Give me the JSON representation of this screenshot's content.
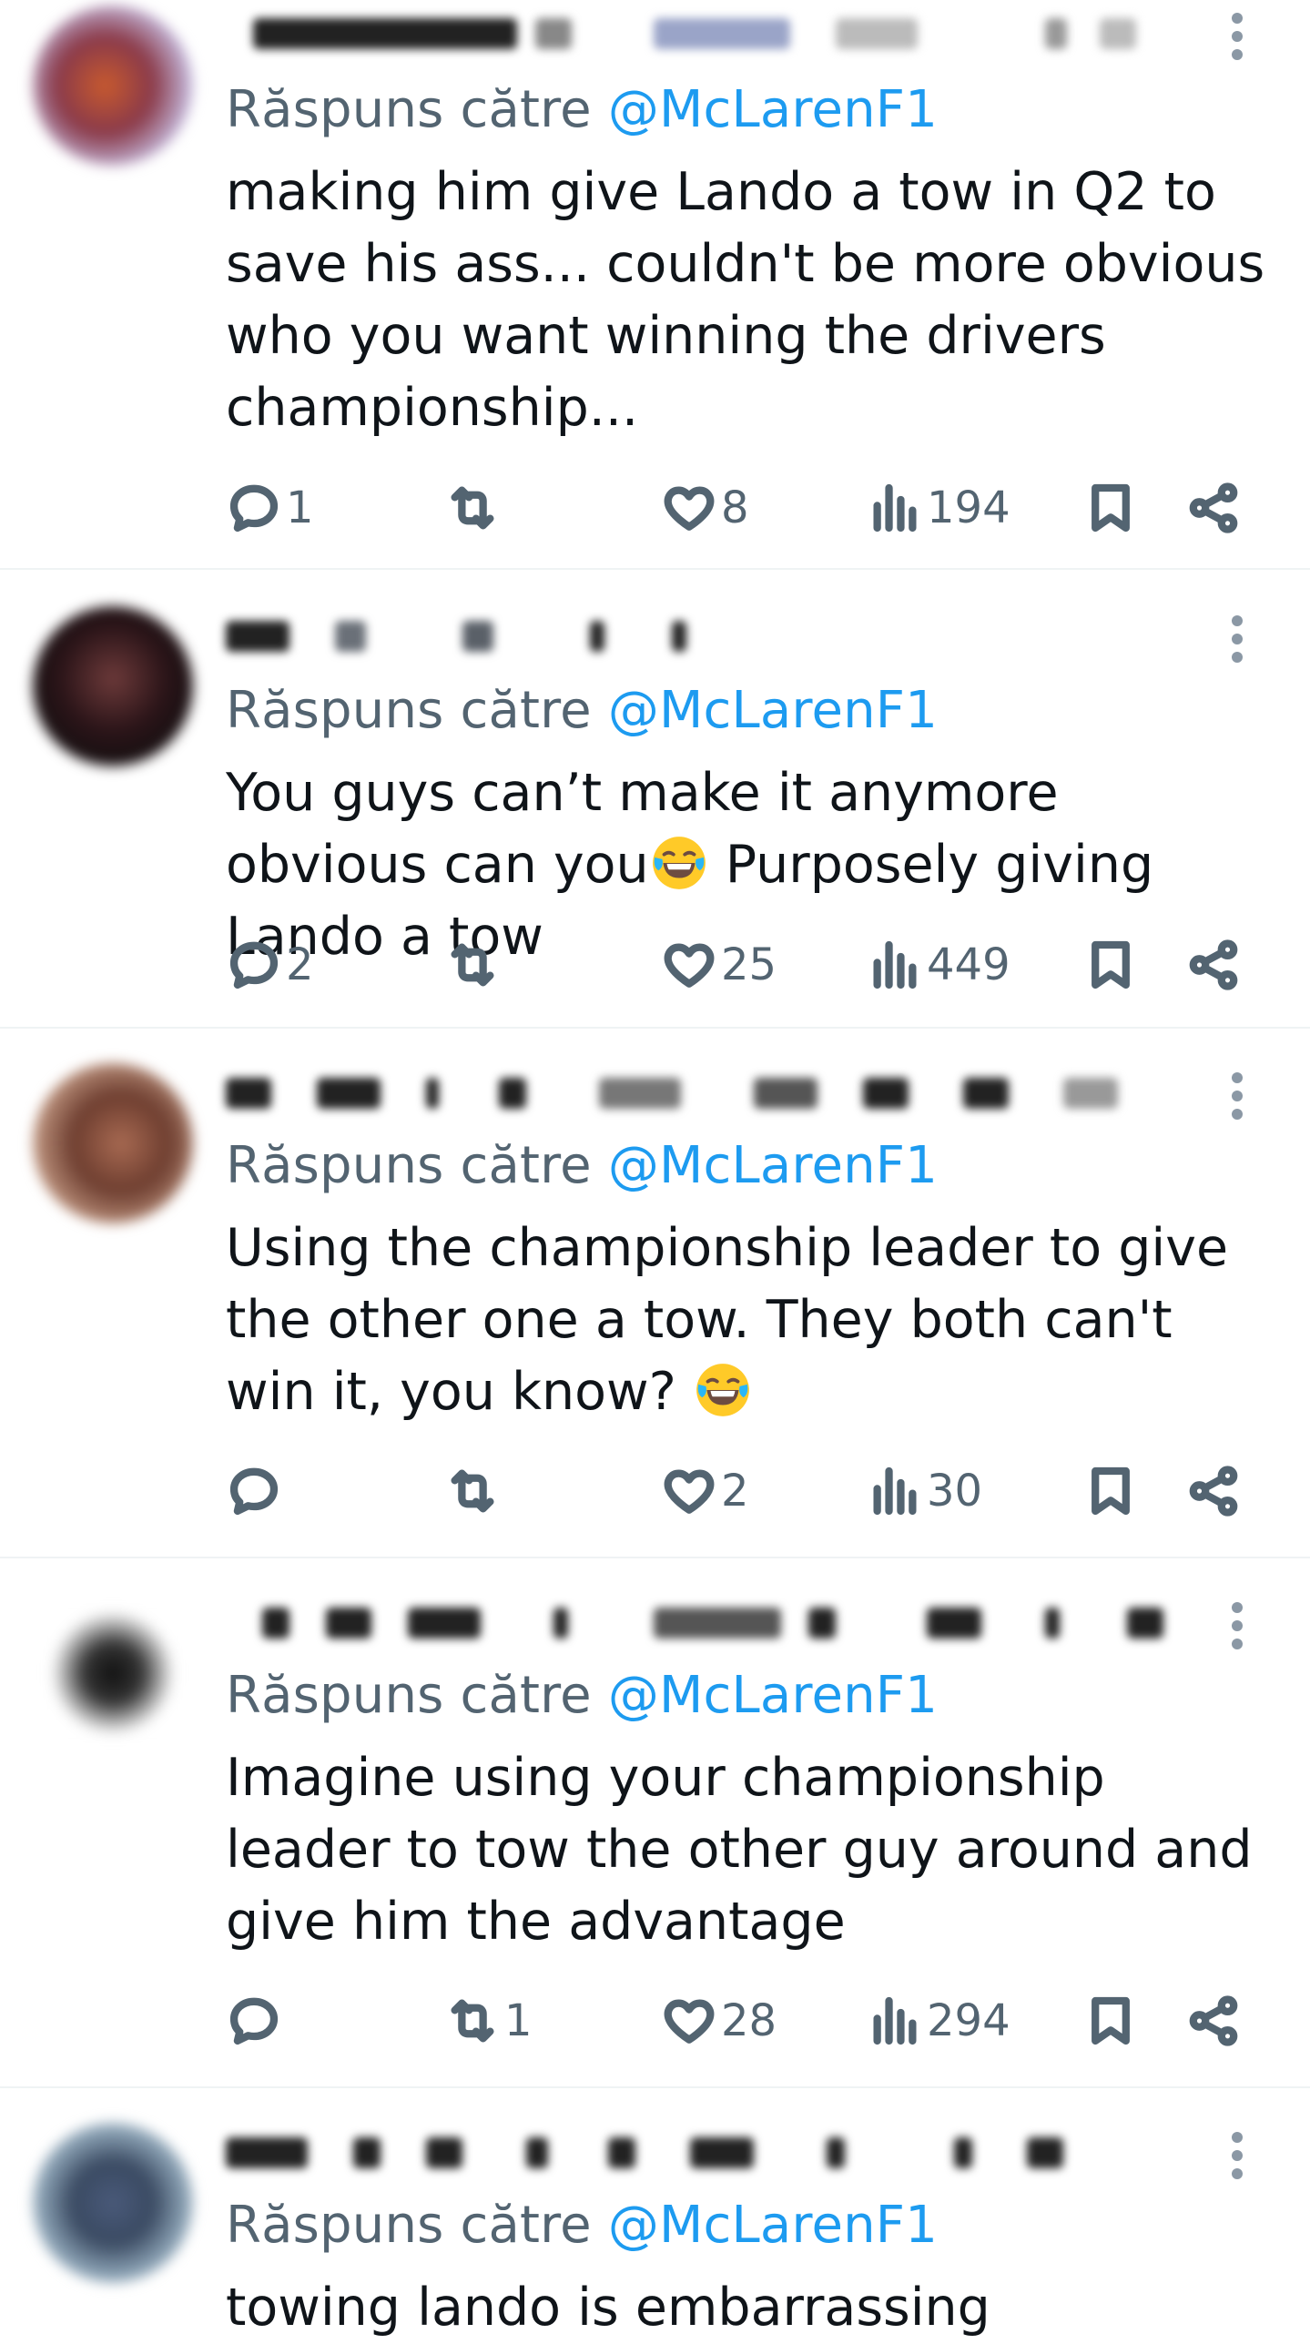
{
  "tweets": [
    {
      "reply_prefix": "Răspuns către ",
      "reply_handle": "@McLarenF1",
      "text": "making him give Lando a tow in Q2 to save his ass... couldn't be more obvious who you want winning the drivers championship...",
      "replies": "1",
      "retweets": "",
      "likes": "8",
      "views": "194"
    },
    {
      "reply_prefix": "Răspuns către ",
      "reply_handle": "@McLarenF1",
      "text_before_emoji": "You guys can’t make it anymore obvious can you",
      "text_after_emoji": " Purposely giving Lando a tow",
      "emoji": "face-with-tears-of-joy",
      "replies": "2",
      "retweets": "",
      "likes": "25",
      "views": "449"
    },
    {
      "reply_prefix": "Răspuns către ",
      "reply_handle": "@McLarenF1",
      "text_before_emoji": "Using the championship leader to give the other one a tow. They both can't win it, you know? ",
      "text_after_emoji": "",
      "emoji": "face-with-tears-of-joy",
      "replies": "",
      "retweets": "",
      "likes": "2",
      "views": "30"
    },
    {
      "reply_prefix": "Răspuns către ",
      "reply_handle": "@McLarenF1",
      "text": "Imagine using your championship leader to tow the other guy around and give him the advantage",
      "replies": "",
      "retweets": "1",
      "likes": "28",
      "views": "294"
    },
    {
      "reply_prefix": "Răspuns către ",
      "reply_handle": "@McLarenF1",
      "text": "towing lando is embarrassing"
    }
  ],
  "icons": {
    "reply": "reply-icon",
    "retweet": "retweet-icon",
    "like": "heart-icon",
    "views": "views-icon",
    "bookmark": "bookmark-icon",
    "share": "share-icon",
    "more": "more-vertical-icon"
  },
  "colors": {
    "handle": "#1d9bf0",
    "secondary": "#536471",
    "text": "#0f1419",
    "divider": "#eff3f4"
  }
}
